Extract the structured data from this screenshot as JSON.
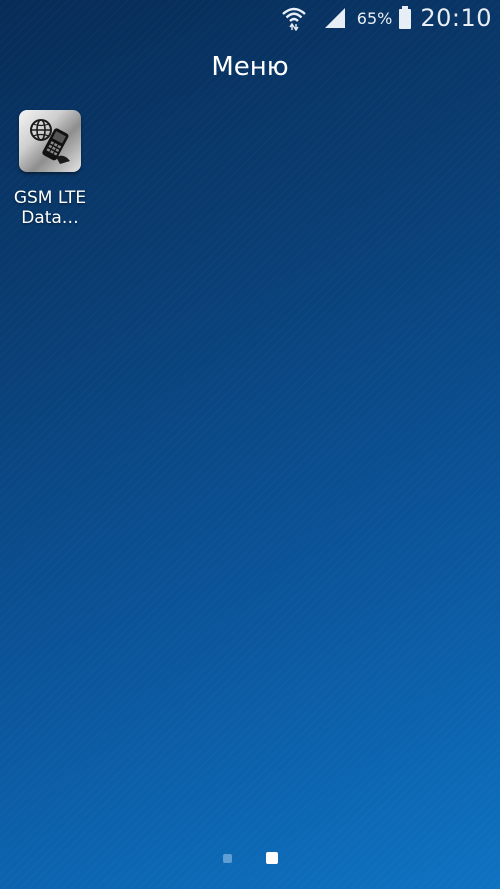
{
  "status_bar": {
    "battery_percent": "65%",
    "time": "20:10",
    "icons": [
      "wifi-icon",
      "signal-icon",
      "battery-icon"
    ]
  },
  "menu": {
    "title": "Меню"
  },
  "apps": [
    {
      "label": "GSM LTE Data…",
      "icon": "gsm-lte-app-icon"
    }
  ],
  "pager": {
    "pages": 2,
    "current_page": 2
  },
  "colors": {
    "background_top": "#072c57",
    "background_bottom": "#0e73c2",
    "text": "#ffffff"
  }
}
